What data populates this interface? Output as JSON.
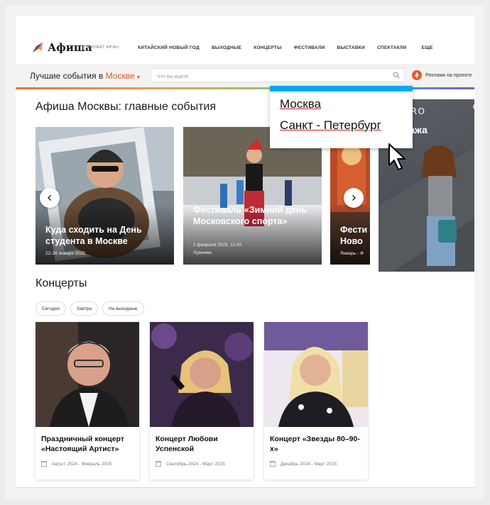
{
  "colors": {
    "accent": "#e05a1f",
    "dropdown_bar": "#00aaf0",
    "mic": "#e8562a"
  },
  "header": {
    "logo": "Афиша",
    "logo_sub": "ПРОЕКТ KP.RU",
    "nav": [
      "КИТАЙСКИЙ НОВЫЙ ГОД",
      "ВЫХОДНЫЕ",
      "КОНЦЕРТЫ",
      "ФЕСТИВАЛИ",
      "ВЫСТАВКИ",
      "СПЕКТАКЛИ",
      "ЕЩЕ"
    ]
  },
  "search": {
    "city_prefix": "Лучшие события в",
    "city": "Москве",
    "placeholder": "Что вы ищете",
    "ad_link": "Реклама на проекте"
  },
  "dropdown": {
    "items": [
      "Москва",
      "Санкт - Петербург"
    ]
  },
  "main": {
    "title": "Афиша Москвы: главные события",
    "cards": [
      {
        "title": "Куда сходить на День студента в Москве",
        "meta": "22-26 января 2025"
      },
      {
        "title": "Фестиваль «Зимний день Московского спорта»",
        "meta": "2 февраля 2025, 11:00",
        "meta2": "Лужники"
      },
      {
        "title": "Фести Ново",
        "meta": "Январь - Ф"
      }
    ],
    "ad": {
      "brand": "QUADRO",
      "sale": "одажа\n0%"
    }
  },
  "concerts": {
    "title": "Концерты",
    "filters": [
      "Сегодня",
      "Завтра",
      "На выходные"
    ],
    "items": [
      {
        "title": "Праздничный концерт «Настоящий Артист»",
        "date": "Август 2024 - Февраль 2025"
      },
      {
        "title": "Концерт Любови Успенской",
        "date": "Сентябрь 2024 - Март 2025"
      },
      {
        "title": "Концерт «Звезды 80–90-х»",
        "date": "Декабрь 2024 - Март 2025"
      }
    ]
  }
}
